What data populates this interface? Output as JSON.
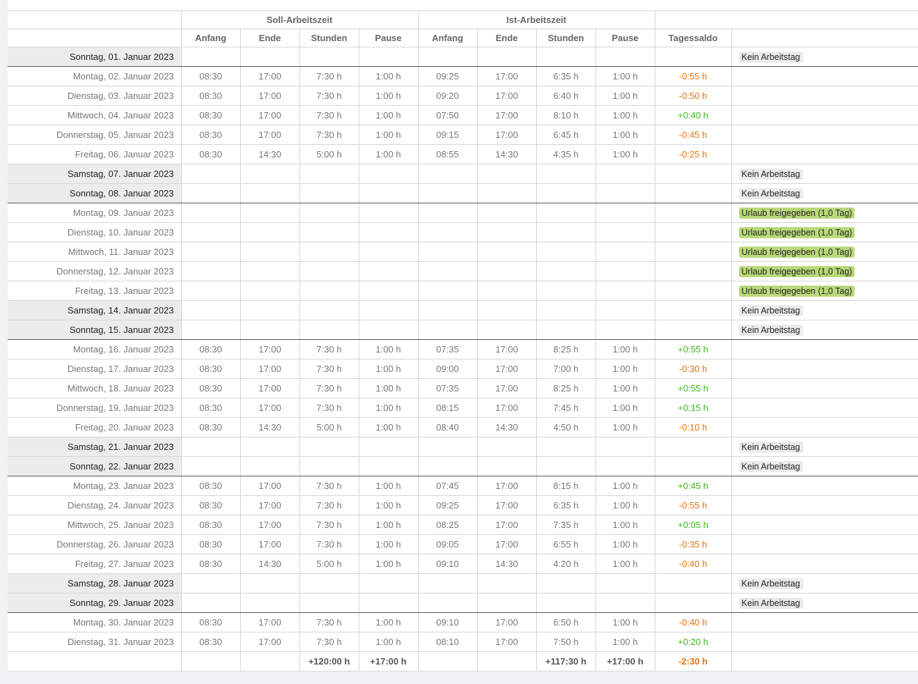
{
  "headers": {
    "soll": "Soll-Arbeitszeit",
    "ist": "Ist-Arbeitszeit",
    "anfang": "Anfang",
    "ende": "Ende",
    "stunden": "Stunden",
    "pause": "Pause",
    "saldo": "Tagessaldo"
  },
  "colors": {
    "negative": "#e8720c",
    "positive": "#3cb81c",
    "vacation": "#b9d97a"
  },
  "rows": [
    {
      "date": "Sonntag, 01. Januar 2023",
      "weekend": true,
      "sunday": true,
      "note": "Kein Arbeitstag"
    },
    {
      "date": "Montag, 02. Januar 2023",
      "v": [
        "08:30",
        "17:00",
        "7:30 h",
        "1:00 h",
        "09:25",
        "17:00",
        "6:35 h",
        "1:00 h"
      ],
      "saldo": "-0:55 h"
    },
    {
      "date": "Dienstag, 03. Januar 2023",
      "v": [
        "08:30",
        "17:00",
        "7:30 h",
        "1:00 h",
        "09:20",
        "17:00",
        "6:40 h",
        "1:00 h"
      ],
      "saldo": "-0:50 h"
    },
    {
      "date": "Mittwoch, 04. Januar 2023",
      "v": [
        "08:30",
        "17:00",
        "7:30 h",
        "1:00 h",
        "07:50",
        "17:00",
        "8:10 h",
        "1:00 h"
      ],
      "saldo": "+0:40 h"
    },
    {
      "date": "Donnerstag, 05. Januar 2023",
      "v": [
        "08:30",
        "17:00",
        "7:30 h",
        "1:00 h",
        "09:15",
        "17:00",
        "6:45 h",
        "1:00 h"
      ],
      "saldo": "-0:45 h"
    },
    {
      "date": "Freitag, 06. Januar 2023",
      "v": [
        "08:30",
        "14:30",
        "5:00 h",
        "1:00 h",
        "08:55",
        "14:30",
        "4:35 h",
        "1:00 h"
      ],
      "saldo": "-0:25 h"
    },
    {
      "date": "Samstag, 07. Januar 2023",
      "weekend": true,
      "note": "Kein Arbeitstag"
    },
    {
      "date": "Sonntag, 08. Januar 2023",
      "weekend": true,
      "sunday": true,
      "note": "Kein Arbeitstag"
    },
    {
      "date": "Montag, 09. Januar 2023",
      "note": "Urlaub freigegeben (1,0 Tag)",
      "vacation": true
    },
    {
      "date": "Dienstag, 10. Januar 2023",
      "note": "Urlaub freigegeben (1,0 Tag)",
      "vacation": true
    },
    {
      "date": "Mittwoch, 11. Januar 2023",
      "note": "Urlaub freigegeben (1,0 Tag)",
      "vacation": true
    },
    {
      "date": "Donnerstag, 12. Januar 2023",
      "note": "Urlaub freigegeben (1,0 Tag)",
      "vacation": true
    },
    {
      "date": "Freitag, 13. Januar 2023",
      "note": "Urlaub freigegeben (1,0 Tag)",
      "vacation": true
    },
    {
      "date": "Samstag, 14. Januar 2023",
      "weekend": true,
      "note": "Kein Arbeitstag"
    },
    {
      "date": "Sonntag, 15. Januar 2023",
      "weekend": true,
      "sunday": true,
      "note": "Kein Arbeitstag"
    },
    {
      "date": "Montag, 16. Januar 2023",
      "v": [
        "08:30",
        "17:00",
        "7:30 h",
        "1:00 h",
        "07:35",
        "17:00",
        "8:25 h",
        "1:00 h"
      ],
      "saldo": "+0:55 h"
    },
    {
      "date": "Dienstag, 17. Januar 2023",
      "v": [
        "08:30",
        "17:00",
        "7:30 h",
        "1:00 h",
        "09:00",
        "17:00",
        "7:00 h",
        "1:00 h"
      ],
      "saldo": "-0:30 h"
    },
    {
      "date": "Mittwoch, 18. Januar 2023",
      "v": [
        "08:30",
        "17:00",
        "7:30 h",
        "1:00 h",
        "07:35",
        "17:00",
        "8:25 h",
        "1:00 h"
      ],
      "saldo": "+0:55 h"
    },
    {
      "date": "Donnerstag, 19. Januar 2023",
      "v": [
        "08:30",
        "17:00",
        "7:30 h",
        "1:00 h",
        "08:15",
        "17:00",
        "7:45 h",
        "1:00 h"
      ],
      "saldo": "+0:15 h"
    },
    {
      "date": "Freitag, 20. Januar 2023",
      "v": [
        "08:30",
        "14:30",
        "5:00 h",
        "1:00 h",
        "08:40",
        "14:30",
        "4:50 h",
        "1:00 h"
      ],
      "saldo": "-0:10 h"
    },
    {
      "date": "Samstag, 21. Januar 2023",
      "weekend": true,
      "note": "Kein Arbeitstag"
    },
    {
      "date": "Sonntag, 22. Januar 2023",
      "weekend": true,
      "sunday": true,
      "note": "Kein Arbeitstag"
    },
    {
      "date": "Montag, 23. Januar 2023",
      "v": [
        "08:30",
        "17:00",
        "7:30 h",
        "1:00 h",
        "07:45",
        "17:00",
        "8:15 h",
        "1:00 h"
      ],
      "saldo": "+0:45 h"
    },
    {
      "date": "Dienstag, 24. Januar 2023",
      "v": [
        "08:30",
        "17:00",
        "7:30 h",
        "1:00 h",
        "09:25",
        "17:00",
        "6:35 h",
        "1:00 h"
      ],
      "saldo": "-0:55 h"
    },
    {
      "date": "Mittwoch, 25. Januar 2023",
      "v": [
        "08:30",
        "17:00",
        "7:30 h",
        "1:00 h",
        "08:25",
        "17:00",
        "7:35 h",
        "1:00 h"
      ],
      "saldo": "+0:05 h"
    },
    {
      "date": "Donnerstag, 26. Januar 2023",
      "v": [
        "08:30",
        "17:00",
        "7:30 h",
        "1:00 h",
        "09:05",
        "17:00",
        "6:55 h",
        "1:00 h"
      ],
      "saldo": "-0:35 h"
    },
    {
      "date": "Freitag, 27. Januar 2023",
      "v": [
        "08:30",
        "14:30",
        "5:00 h",
        "1:00 h",
        "09:10",
        "14:30",
        "4:20 h",
        "1:00 h"
      ],
      "saldo": "-0:40 h"
    },
    {
      "date": "Samstag, 28. Januar 2023",
      "weekend": true,
      "note": "Kein Arbeitstag"
    },
    {
      "date": "Sonntag, 29. Januar 2023",
      "weekend": true,
      "sunday": true,
      "note": "Kein Arbeitstag"
    },
    {
      "date": "Montag, 30. Januar 2023",
      "v": [
        "08:30",
        "17:00",
        "7:30 h",
        "1:00 h",
        "09:10",
        "17:00",
        "6:50 h",
        "1:00 h"
      ],
      "saldo": "-0:40 h"
    },
    {
      "date": "Dienstag, 31. Januar 2023",
      "v": [
        "08:30",
        "17:00",
        "7:30 h",
        "1:00 h",
        "08:10",
        "17:00",
        "7:50 h",
        "1:00 h"
      ],
      "saldo": "+0:20 h"
    }
  ],
  "totals": {
    "v": [
      "",
      "",
      "+120:00 h",
      "+17:00 h",
      "",
      "",
      "+117:30 h",
      "+17:00 h"
    ],
    "saldo": "-2:30 h"
  }
}
